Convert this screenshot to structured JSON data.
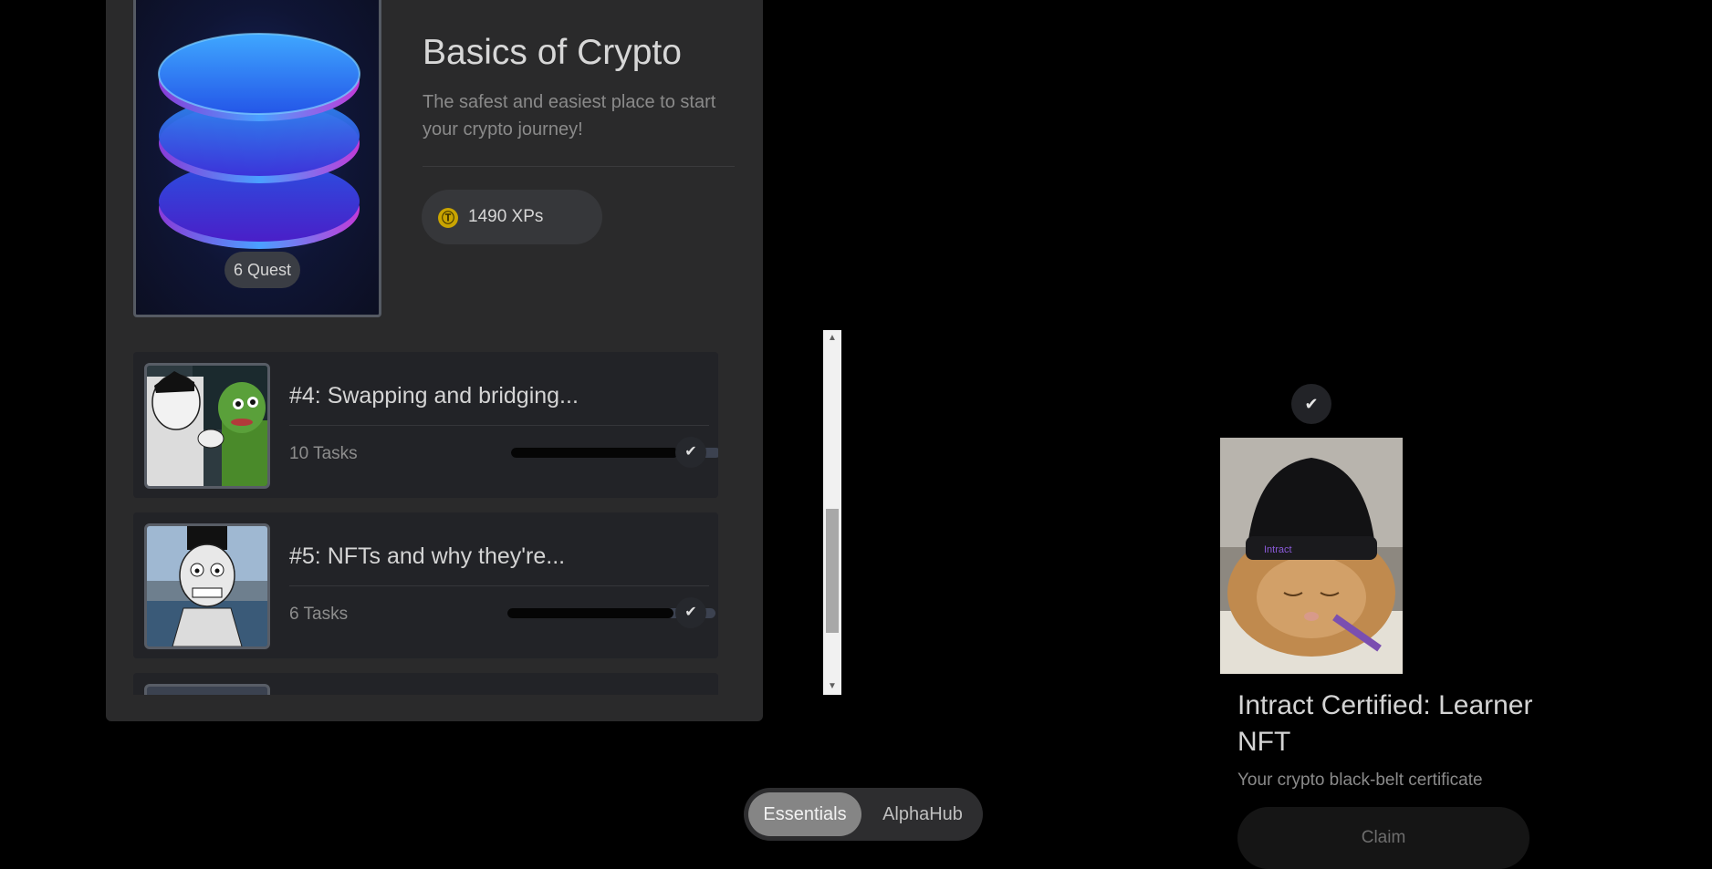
{
  "course": {
    "title": "Basics of Crypto",
    "subtitle": "The safest and easiest place to start your crypto journey!",
    "quest_count": "6 Quest",
    "xp": "1490 XPs",
    "xp_icon": "coin-icon"
  },
  "quests": [
    {
      "title": "#4: Swapping and bridging...",
      "tasks": "10 Tasks",
      "progress": 0.8,
      "completed": true
    },
    {
      "title": "#5: NFTs and why they're...",
      "tasks": "6 Tasks",
      "progress": 0.8,
      "completed": true
    }
  ],
  "tabs": {
    "active": "Essentials",
    "inactive": "AlphaHub"
  },
  "nft": {
    "title": "Intract Certified: Learner NFT",
    "subtitle": "Your crypto black-belt certificate",
    "claim_label": "Claim",
    "hat_text": "Intract"
  },
  "icons": {
    "check": "✔",
    "scroll_up": "▲",
    "scroll_down": "▼",
    "coin": "Ⓣ"
  },
  "colors": {
    "background": "#000000",
    "panel": "#2a2a2b",
    "accent_coin": "#c9a400"
  }
}
